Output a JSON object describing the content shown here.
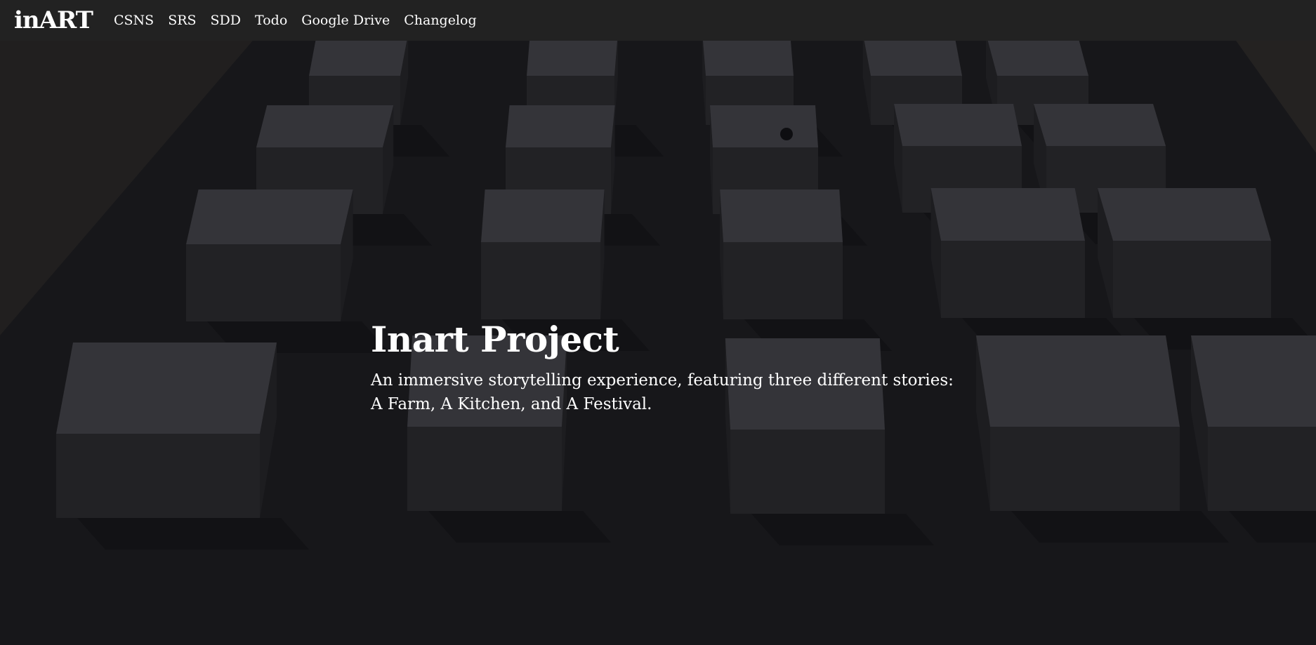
{
  "navbar": {
    "brand": "inART",
    "links": [
      {
        "label": "CSNS"
      },
      {
        "label": "SRS"
      },
      {
        "label": "SDD"
      },
      {
        "label": "Todo"
      },
      {
        "label": "Google Drive"
      },
      {
        "label": "Changelog"
      }
    ]
  },
  "hero": {
    "title": "Inart Project",
    "subtitle_line1": "An immersive storytelling experience, featuring three different stories:",
    "subtitle_line2": "A Farm, A Kitchen, and A Festival.",
    "background": "3d-scene-grey-cubes-image"
  },
  "colors": {
    "navbar_bg": "#222222",
    "text": "#ffffff",
    "cube_top": "#45454a",
    "cube_side": "#2b2b2f",
    "floor": "#1b1b1e"
  }
}
